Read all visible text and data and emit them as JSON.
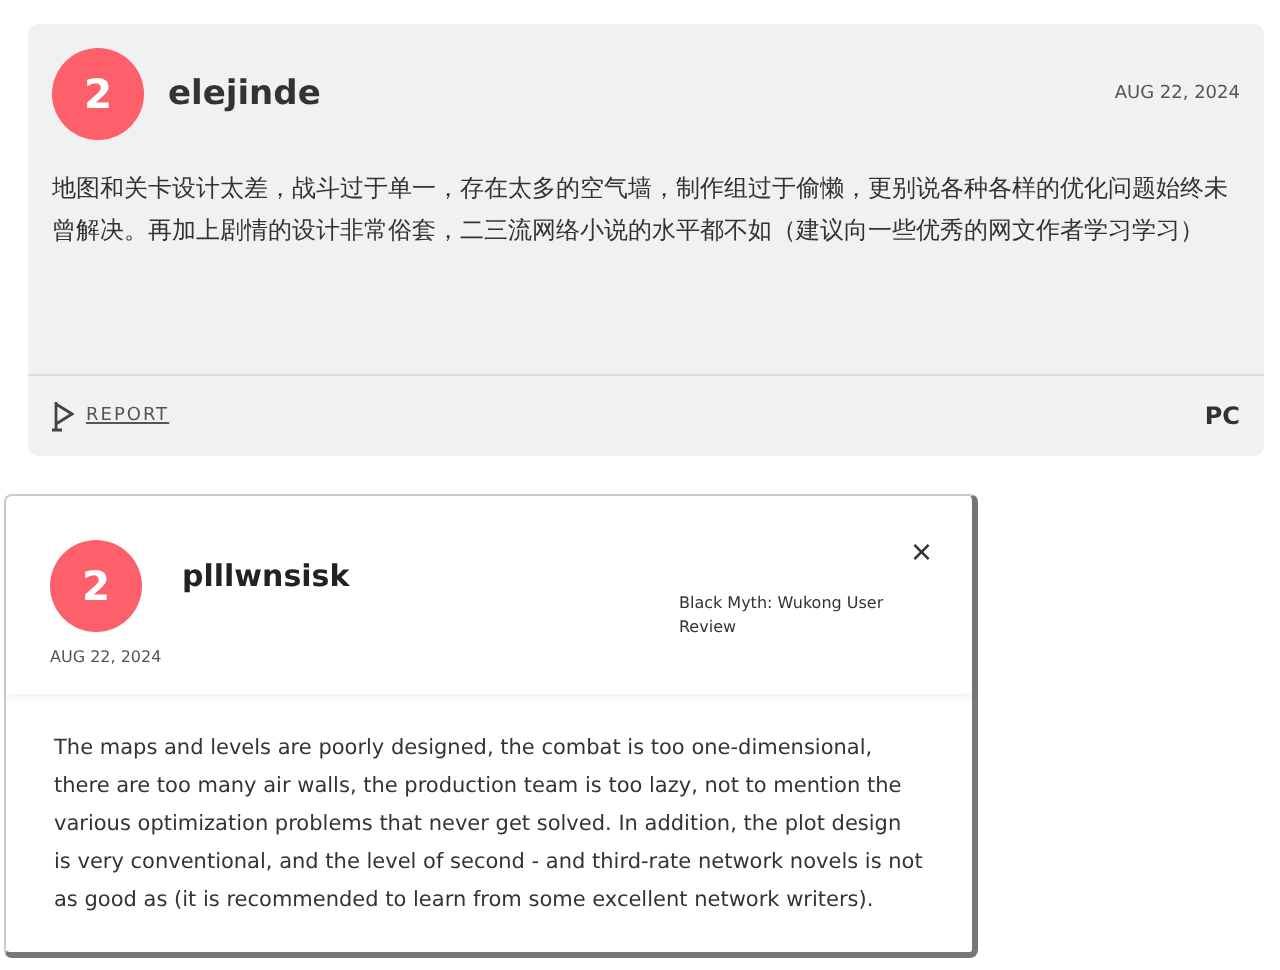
{
  "user_review": {
    "score": "2",
    "username": "elejinde",
    "date": "AUG 22, 2024",
    "text": "地图和关卡设计太差，战斗过于单一，存在太多的空气墙，制作组过于偷懒，更别说各种各样的优化问题始终未曾解决。再加上剧情的设计非常俗套，二三流网络小说的水平都不如（建议向一些优秀的网文作者学习学习）",
    "report": "REPORT",
    "platform": "PC"
  },
  "translated_review": {
    "score": "2",
    "username": "plllwnsisk",
    "date": "AUG 22, 2024",
    "source": "Black Myth: Wukong User Review",
    "close": "×",
    "text": "The maps and levels are poorly designed, the combat is too one-dimensional, there are too many air walls, the production team is too lazy, not to mention the various optimization problems that never get solved. In addition, the plot design is very conventional, and the level of second - and third-rate network novels is not as good as (it is recommended to learn from some excellent network writers)."
  }
}
